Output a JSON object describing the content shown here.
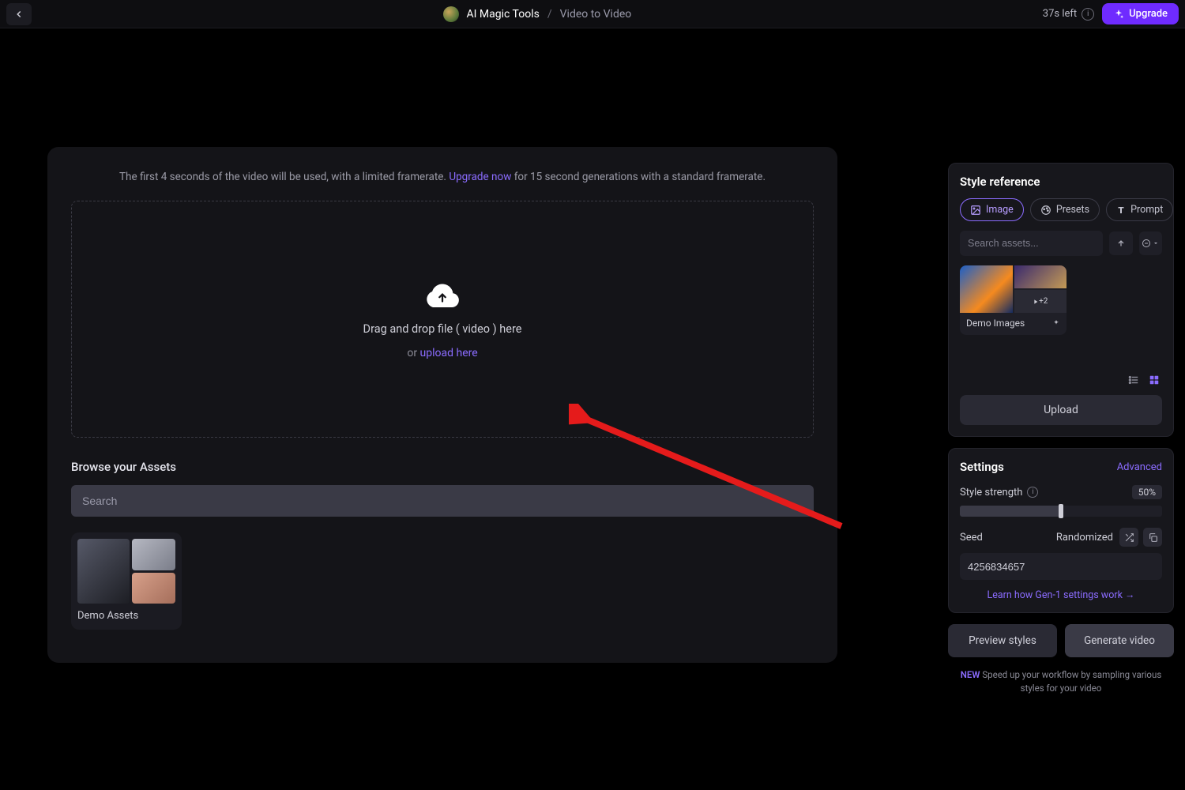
{
  "header": {
    "breadcrumb_root": "AI Magic Tools",
    "breadcrumb_current": "Video to Video",
    "credits_text": "37s left",
    "upgrade_label": "Upgrade"
  },
  "main": {
    "limit_note_prefix": "The first 4 seconds of the video will be used, with a limited framerate. ",
    "limit_note_link": "Upgrade now",
    "limit_note_suffix": " for 15 second generations with a standard framerate.",
    "drop_line": "Drag and drop file ( video ) here",
    "drop_sub_prefix": "or ",
    "drop_sub_link": "upload here",
    "browse_title": "Browse your Assets",
    "asset_search_placeholder": "Search",
    "asset_folder_label": "Demo Assets"
  },
  "style_panel": {
    "title": "Style reference",
    "tabs": {
      "image": "Image",
      "presets": "Presets",
      "prompt": "Prompt"
    },
    "search_placeholder": "Search assets...",
    "demo_label": "Demo Images",
    "demo_extra_count": "+2",
    "upload_label": "Upload"
  },
  "settings": {
    "title": "Settings",
    "advanced": "Advanced",
    "strength_label": "Style strength",
    "strength_value": "50%",
    "seed_label": "Seed",
    "randomized_label": "Randomized",
    "seed_value": "4256834657",
    "learn_link": "Learn how Gen-1 settings work  →"
  },
  "actions": {
    "preview": "Preview styles",
    "generate": "Generate video",
    "footnote_new": "NEW",
    "footnote_text": " Speed up your workflow by sampling various styles for your video"
  }
}
